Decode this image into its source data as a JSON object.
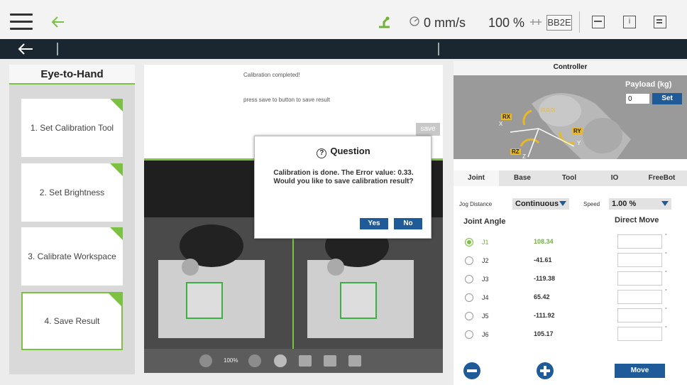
{
  "topbar": {
    "speed": "0 mm/s",
    "percent": "100 %",
    "badge": "BB2E"
  },
  "left_panel": {
    "title": "Eye-to-Hand",
    "steps": [
      {
        "label": "1. Set Calibration Tool"
      },
      {
        "label": "2. Set Brightness"
      },
      {
        "label": "3. Calibrate Workspace"
      },
      {
        "label": "4.  Save Result"
      }
    ]
  },
  "center": {
    "message1": "Calibration completed!",
    "message2": "press save to button to save result",
    "save_label": "save",
    "zoom": "100%"
  },
  "dialog": {
    "title": "Question",
    "body": "Calibration is done. The Error value: 0.33. Would you like to save calibration result?",
    "yes_label": "Yes",
    "no_label": "No"
  },
  "right_panel": {
    "title": "Controller",
    "payload_label": "Payload (kg)",
    "payload_value": "0",
    "set_label": "Set",
    "axes": [
      "RX",
      "RY",
      "RZ",
      "X",
      "Y",
      "Z",
      "(0,0,0)"
    ],
    "tabs": [
      "Joint",
      "Base",
      "Tool",
      "IO",
      "FreeBot"
    ],
    "jog_label": "Jog Distance",
    "jog_value": "Continuous",
    "speed_label": "Speed",
    "speed_value": "1.00 %",
    "joint_header": "Joint Angle",
    "direct_header": "Direct Move",
    "joints": [
      {
        "name": "J1",
        "value": "108.34",
        "selected": true
      },
      {
        "name": "J2",
        "value": "-41.61",
        "selected": false
      },
      {
        "name": "J3",
        "value": "-119.38",
        "selected": false
      },
      {
        "name": "J4",
        "value": "65.42",
        "selected": false
      },
      {
        "name": "J5",
        "value": "-111.92",
        "selected": false
      },
      {
        "name": "J6",
        "value": "105.17",
        "selected": false
      }
    ],
    "degree_symbol": "°",
    "move_label": "Move"
  },
  "colors": {
    "accent_green": "#7cc242",
    "primary_blue": "#1f5a99",
    "navbar": "#1a2630"
  }
}
